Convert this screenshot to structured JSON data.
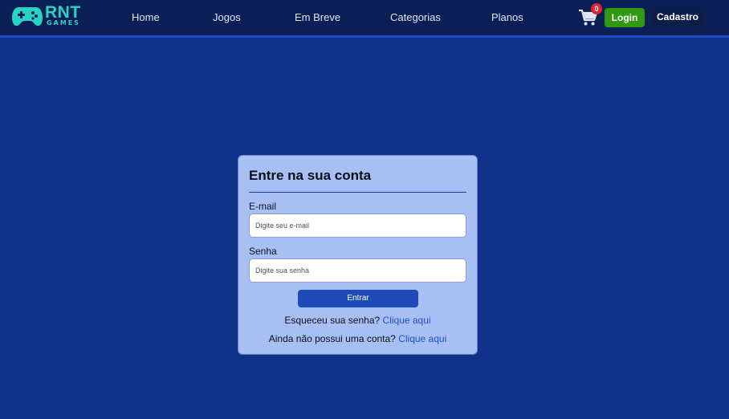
{
  "brand": {
    "name": "RNT",
    "subtitle": "GAMES",
    "icon": "gamepad-icon",
    "color": "#27d3c2"
  },
  "nav": {
    "links": [
      "Home",
      "Jogos",
      "Em Breve",
      "Categorias",
      "Planos"
    ]
  },
  "cart": {
    "icon": "cart-icon",
    "count": "0"
  },
  "auth": {
    "login_label": "Login",
    "signup_label": "Cadastro"
  },
  "login_form": {
    "title": "Entre na sua conta",
    "email": {
      "label": "E-mail",
      "placeholder": "Digite seu e-mail",
      "value": ""
    },
    "password": {
      "label": "Senha",
      "placeholder": "Digite sua senha",
      "value": ""
    },
    "submit_label": "Entrar",
    "forgot_text": "Esqueceu sua senha?",
    "forgot_link": "Clique aqui",
    "signup_text": "Ainda não possui uma conta?",
    "signup_link": "Clique aqui"
  },
  "colors": {
    "page_background": "#0f318a",
    "navbar": "#0a1f56",
    "card": "#a7bff3",
    "login_button": "#2f9a10",
    "submit_button": "#1d4bb8",
    "link": "#1f52c9",
    "badge": "#e0242b"
  }
}
